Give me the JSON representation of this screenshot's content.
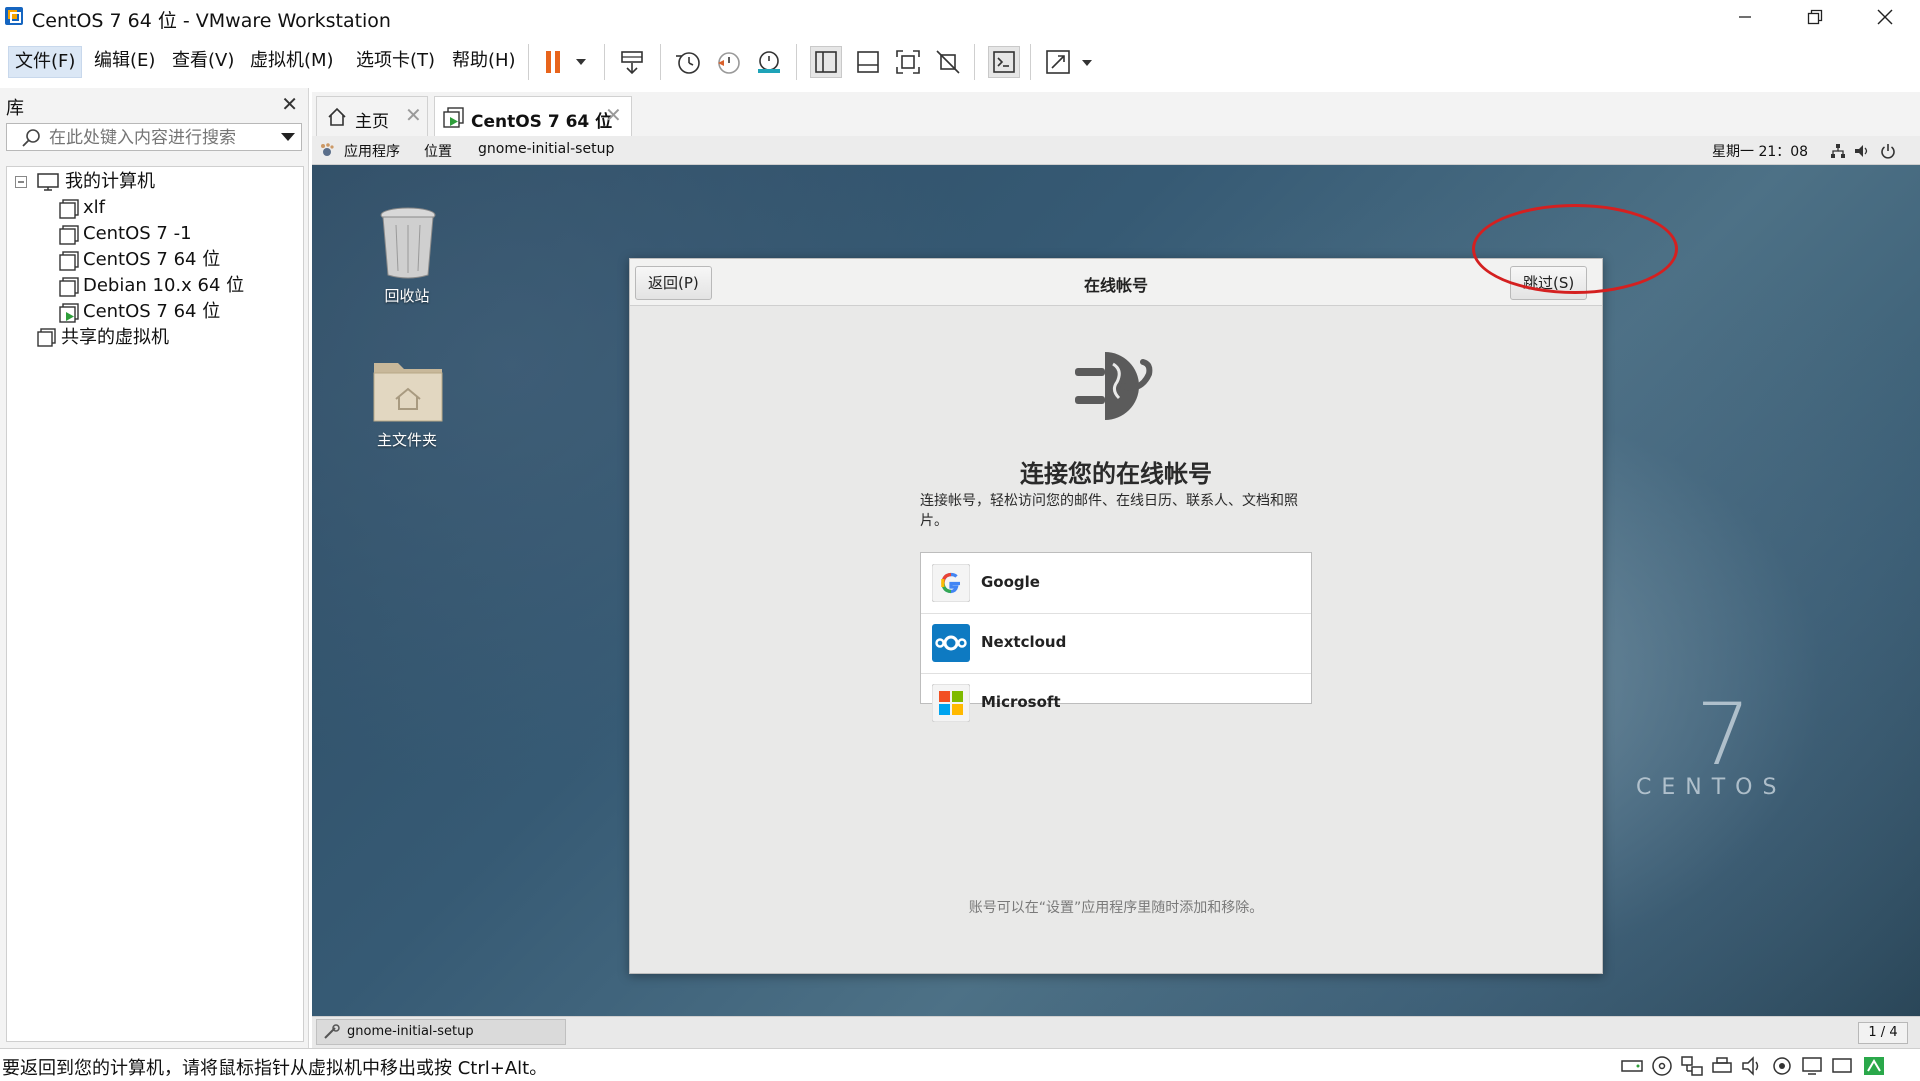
{
  "window": {
    "title": "CentOS 7 64 位 - VMware Workstation"
  },
  "menu": {
    "items": [
      "文件(F)",
      "编辑(E)",
      "查看(V)",
      "虚拟机(M)",
      "选项卡(T)",
      "帮助(H)"
    ]
  },
  "library": {
    "title": "库",
    "search_placeholder": "在此处键入内容进行搜索",
    "tree": {
      "root": "我的计算机",
      "vms": [
        "xlf",
        "CentOS 7 -1",
        "CentOS 7 64 位",
        "Debian 10.x 64 位",
        "CentOS 7 64 位"
      ],
      "shared": "共享的虚拟机"
    }
  },
  "tabs": {
    "home": "主页",
    "vm": "CentOS 7 64 位"
  },
  "guest": {
    "topbar": {
      "apps": "应用程序",
      "places": "位置",
      "window": "gnome-initial-setup",
      "clock": "星期一 21：08"
    },
    "desktop": {
      "trash": "回收站",
      "home_folder": "主文件夹",
      "brand_number": "7",
      "brand_word": "CENTOS"
    },
    "dialog": {
      "back": "返回(P)",
      "title": "在线帐号",
      "skip": "跳过(S)",
      "heading": "连接您的在线帐号",
      "description": "连接帐号，轻松访问您的邮件、在线日历、联系人、文档和照片。",
      "providers": [
        "Google",
        "Nextcloud",
        "Microsoft"
      ],
      "footer": "账号可以在“设置”应用程序里随时添加和移除。"
    },
    "taskbar": {
      "item": "gnome-initial-setup",
      "workspace": "1 / 4"
    }
  },
  "statusbar": {
    "text": "要返回到您的计算机，请将鼠标指针从虚拟机中移出或按 Ctrl+Alt。"
  },
  "colors": {
    "accent_annotation": "#d42020",
    "pause_icon": "#e8641b"
  }
}
